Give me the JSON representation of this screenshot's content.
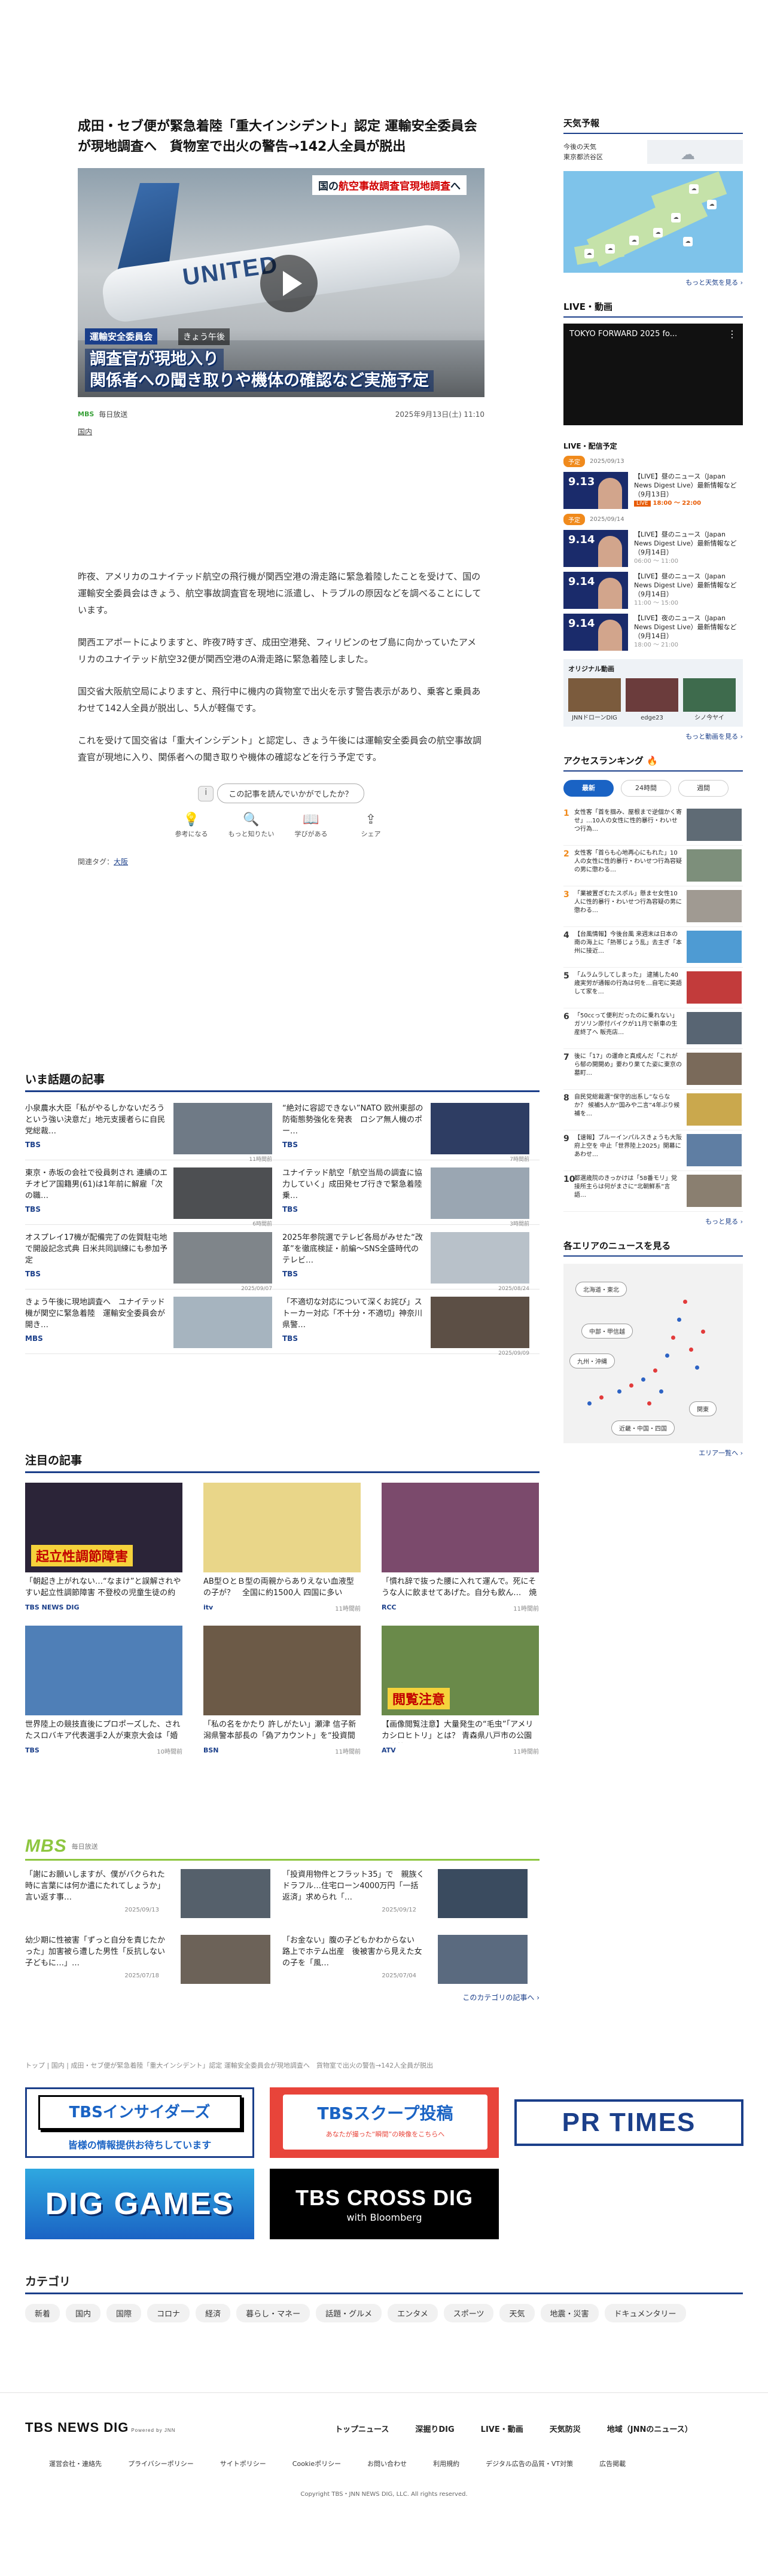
{
  "article": {
    "title": "成田・セブ便が緊急着陸「重大インシデント」認定 運輸安全委員会が現地調査へ　貨物室で出火の警告→142人全員が脱出",
    "hero": {
      "caption_top_prefix": "国の",
      "caption_top_highlight": "航空事故調査官現地調査",
      "caption_top_suffix": "へ",
      "tag": "運輸安全委員会",
      "time": "きょう午後",
      "main_line1": "調査官が現地入り",
      "main_line2": "関係者への聞き取りや機体の確認など実施予定",
      "play_icon": "play-icon",
      "tail_text": "UNITED"
    },
    "source_logo": "MBS",
    "source": "毎日放送",
    "date": "2025年9月13日(土) 11:10",
    "category": "国内",
    "paragraphs": [
      "昨夜、アメリカのユナイテッド航空の飛行機が関西空港の滑走路に緊急着陸したことを受けて、国の運輸安全委員会はきょう、航空事故調査官を現地に派遣し、トラブルの原因などを調べることにしています。",
      "関西エアポートによりますと、昨夜7時すぎ、成田空港発、フィリピンのセブ島に向かっていたアメリカのユナイテッド航空32便が関西空港のA滑走路に緊急着陸しました。",
      "国交省大阪航空局によりますと、飛行中に機内の貨物室で出火を示す警告表示があり、乗客と乗員あわせて142人全員が脱出し、5人が軽傷です。",
      "これを受けて国交省は「重大インシデント」と認定し、きょう午後には運輸安全委員会の航空事故調査官が現地に入り、関係者への聞き取りや機体の確認などを行う予定です。"
    ],
    "feedback_question": "この記事を読んでいかがでしたか？",
    "feedback_options": [
      {
        "icon": "💡",
        "label": "参考になる"
      },
      {
        "icon": "🔍",
        "label": "もっと知りたい"
      },
      {
        "icon": "📖",
        "label": "学びがある"
      },
      {
        "icon": "⇪",
        "label": "シェア"
      }
    ],
    "tags_label": "関連タグ：",
    "tag_link": "大阪"
  },
  "trending": {
    "heading": "いま話題の記事",
    "items": [
      {
        "title": "小泉農水大臣「私がやるしかないだろうという強い決意だ」地元支援者らに自民党総裁…",
        "source": "TBS",
        "time": "11時間前",
        "color": "#6f7a86"
      },
      {
        "title": "“絶対に容認できない”NATO 欧州東部の防衛態勢強化を発表　ロシア無人機のポー…",
        "source": "TBS",
        "time": "7時間前",
        "color": "#2e3d63"
      },
      {
        "title": "東京・赤坂の会社で役員刺され 連續のエチオピア国籍男(61)は1年前に解雇「次の職…",
        "source": "TBS",
        "time": "6時間前",
        "color": "#4d4f52"
      },
      {
        "title": "ユナイテッド航空「航空当局の調査に協力していく」成田発セブ行きで緊急着陸　乗…",
        "source": "TBS",
        "time": "3時間前",
        "color": "#9aa6b2"
      },
      {
        "title": "オスプレイ17機が配備完了の佐賀駐屯地で開設記念式典 日米共同訓練にも参加予定",
        "source": "TBS",
        "time": "2025/09/07",
        "color": "#7f858a"
      },
      {
        "title": "2025年参院選でテレビ各局がみせた“改革”を徹底検証・前編～SNS全盛時代のテレビ…",
        "source": "TBS",
        "time": "2025/08/24",
        "color": "#b8c1c9"
      },
      {
        "title": "きょう午後に現地調査へ　ユナイテッド機が関空に緊急着陸　運輸安全委員会が開き…",
        "source": "MBS",
        "time": "",
        "color": "#a6b4bf"
      },
      {
        "title": "「不適切な対応について深くお詫び」ストーカー対応「不十分・不適切」神奈川県警…",
        "source": "TBS",
        "time": "2025/09/09",
        "color": "#5c4f45"
      }
    ]
  },
  "featured": {
    "heading": "注目の記事",
    "items": [
      {
        "title": "「朝起き上がれない…“なまけ”と誤解されやすい起立性調節障害 不登校の児童生徒の約４割が苦しむ…",
        "source": "TBS NEWS DIG",
        "time": "",
        "color": "#2b2438",
        "caption": "起立性調節障害"
      },
      {
        "title": "AB型ＯとＢ型の両親からありえない血液型の子が？　全国に約1500人 四国に多い「cisAB型」とは",
        "source": "itv",
        "time": "11時間前",
        "color": "#e9d689",
        "caption": ""
      },
      {
        "title": "「慣れ辞で抜った腰に入れて運んで。死にそうな人に飲ませてあげた。自分も飲ん…　焼野原で見…",
        "source": "RCC",
        "time": "11時間前",
        "color": "#7b4a6c",
        "caption": ""
      },
      {
        "title": "世界陸上の競技直後にプロポーズした、されたスロバキア代表選手2人が東京大会は「婚約者」として「…",
        "source": "TBS",
        "time": "10時間前",
        "color": "#4f7fb7",
        "caption": ""
      },
      {
        "title": "「私の名をかたり 許しがたい」瀬津 信子新潟県警本部長の「偽アカウント」を“投資間連”のLINEグルー…",
        "source": "BSN",
        "time": "11時間前",
        "color": "#6c5a47",
        "caption": ""
      },
      {
        "title": "【画像閲覧注意】大量発生の“毛虫”「アメリカシロヒトリ」とは？ 青森県八戸市の公園や学校に“うじ…",
        "source": "ATV",
        "time": "11時間前",
        "color": "#6a8a4a",
        "caption": "閲覧注意"
      }
    ]
  },
  "mbs": {
    "logo": "MBS",
    "label": "毎日放送",
    "items": [
      {
        "title": "「謝にお願いしますが、僕がバクられた時に言葉には何か遣にたれてしょうか」言い返す事…",
        "time": "2025/09/13",
        "color": "#55606b"
      },
      {
        "title": "「投資用物件とフラット35」で　親族くドラフル…住宅ローン4000万円「一括返済」求められ「…",
        "time": "2025/09/12",
        "color": "#3a4b5f"
      },
      {
        "title": "幼少期に性被害「ずっと自分を責じたかった」加害被ら遭した男性「反抗しない子どもに…」…",
        "time": "2025/07/18",
        "color": "#6c6258"
      },
      {
        "title": "「お金ない」腹の子どもかわからない　路上でホテム出産　後被害から見えた女の子を「風…",
        "time": "2025/07/04",
        "color": "#5a6a7f"
      }
    ],
    "more": "このカテゴリの記事へ ›"
  },
  "breadcrumb": "トップ | 国内 | 成田・セブ便が緊急着陸「重大インシデント」認定 運輸安全委員会が現地調査へ　貨物室で出火の警告→142人全員が脱出",
  "banners": {
    "insider_title": "TBSインサイダーズ",
    "insider_sub": "皆様の情報提供お待ちしています",
    "scoop_title": "TBSスクープ投稿",
    "scoop_sub": "あなたが撮った“瞬間”の映像をこちらへ",
    "prtimes": "PR TIMES",
    "diggames": "DIG GAMES",
    "crossdig": "TBS CROSS DIG",
    "crossdig_sub": "with Bloomberg"
  },
  "categories": {
    "heading": "カテゴリ",
    "items": [
      "新着",
      "国内",
      "国際",
      "コロナ",
      "経済",
      "暮らし・マネー",
      "話題・グルメ",
      "エンタメ",
      "スポーツ",
      "天気",
      "地震・災害",
      "ドキュメンタリー"
    ]
  },
  "footer": {
    "brand": "TBS NEWS DIG",
    "brand_sub": "Powered by JNN",
    "nav_primary": [
      "トップニュース",
      "深掘りDIG",
      "LIVE・動画",
      "天気防災",
      "地域（JNNのニュース）"
    ],
    "nav_secondary": [
      "運営会社・連絡先",
      "プライバシーポリシー",
      "サイトポリシー",
      "Cookieポリシー",
      "お問い合わせ",
      "利用規約",
      "デジタル広告の品質・VT対策",
      "広告掲載"
    ],
    "copyright": "Copyright TBS・JNN NEWS DIG, LLC. All rights reserved."
  },
  "sidebar": {
    "weather_heading": "天気予報",
    "weather_loc1": "今後の天気",
    "weather_loc2": "東京都渋谷区",
    "weather_icon": "cloud-icon",
    "weather_more": "もっと天気を見る ›",
    "live_heading": "LIVE・動画",
    "live_video_label": "TOKYO FORWARD 2025 fo...",
    "schedule_heading": "LIVE・配信予定",
    "schedule": [
      {
        "tag": "予定",
        "date": "2025/09/13",
        "num": "9.13",
        "title": "【LIVE】昼のニュース（Japan News Digest Live）最新情報など（9月13日）",
        "live": "LIVE",
        "time": "18:00 ～ 22:00"
      },
      {
        "tag": "予定",
        "date": "2025/09/14",
        "num": "9.14",
        "title": "【LIVE】昼のニュース（Japan News Digest Live）最新情報など（9月14日）",
        "live": "",
        "time": "06:00 ～ 11:00"
      },
      {
        "tag": "",
        "date": "",
        "num": "9.14",
        "title": "【LIVE】昼のニュース（Japan News Digest Live）最新情報など（9月14日）",
        "live": "",
        "time": "11:00 ～ 15:00"
      },
      {
        "tag": "",
        "date": "",
        "num": "9.14",
        "title": "【LIVE】夜のニュース（Japan News Digest Live）最新情報など（9月14日）",
        "live": "",
        "time": "18:00 ～ 21:00"
      }
    ],
    "original_heading": "オリジナル動画",
    "original": [
      {
        "label": "JNNドローンDIG",
        "color": "#7b5b3d"
      },
      {
        "label": "edge23",
        "color": "#6b3c3c"
      },
      {
        "label": "シノ今ヤイ",
        "color": "#3e6b4d"
      }
    ],
    "video_more": "もっと動画を見る ›",
    "ranking_heading": "アクセスランキング",
    "ranking_tabs": [
      "最新",
      "24時間",
      "週間"
    ],
    "ranking": [
      {
        "n": "1",
        "title": "女性客「首を掴み、屋根まで逆個かく寄せ」…10人の女性に性的暴行・わいせつ行為…",
        "color": "#5f6b75"
      },
      {
        "n": "2",
        "title": "女性客「首らも心地再心にもれた」10人の女性に性的暴行・わいせつ行為容疑の男に懲わる…",
        "color": "#7d8f7b"
      },
      {
        "n": "3",
        "title": "「業被置ぎむたスポル」懸まセ女性10人に性的暴行・わいせつ行為容疑の男に懲わる…",
        "color": "#a09a92"
      },
      {
        "n": "4",
        "title": "【台風情報】今後台風 来週末は日本の南の海上に「熱帯じょう乱」去主ぎ「本州に接近…",
        "color": "#4e9bd3"
      },
      {
        "n": "5",
        "title": "「ムラムラしてしまった」 逮捕した40歳実労が通報の行為は何を…自宅に英語して家を…",
        "color": "#c23b3b"
      },
      {
        "n": "6",
        "title": "「50ccって便利だったのに乗れない」ガソリン原付バイクが11月で新車の生産終了へ 販売店…",
        "color": "#586573"
      },
      {
        "n": "7",
        "title": "後に「17」の運命と真成んだ「これがら郁の開開め」要わり果てた姿に東京の墓町…",
        "color": "#7a6a5a"
      },
      {
        "n": "8",
        "title": "自民党総裁選“保守的出系し”ならなか？ 候補5人か“国みや二言”4年ぶり候補を…",
        "color": "#caa84d"
      },
      {
        "n": "9",
        "title": "【速報】ブルーインパルスきょうも大阪府上空を 中止「世界陸上2025」開幕にあわせ…",
        "color": "#5f7ea3"
      },
      {
        "n": "10",
        "title": "都選歳院のきっかけは「58番モリ」党接所主らは何がまさに“北朝鮮系”言語…",
        "color": "#8a7f70"
      }
    ],
    "ranking_more": "もっと見る ›",
    "area_heading": "各エリアのニュースを見る",
    "areas": [
      "北海道・東北",
      "中部・甲信越",
      "九州・沖縄",
      "関東",
      "近畿・中国・四国"
    ],
    "area_more": "エリア一覧へ ›"
  }
}
